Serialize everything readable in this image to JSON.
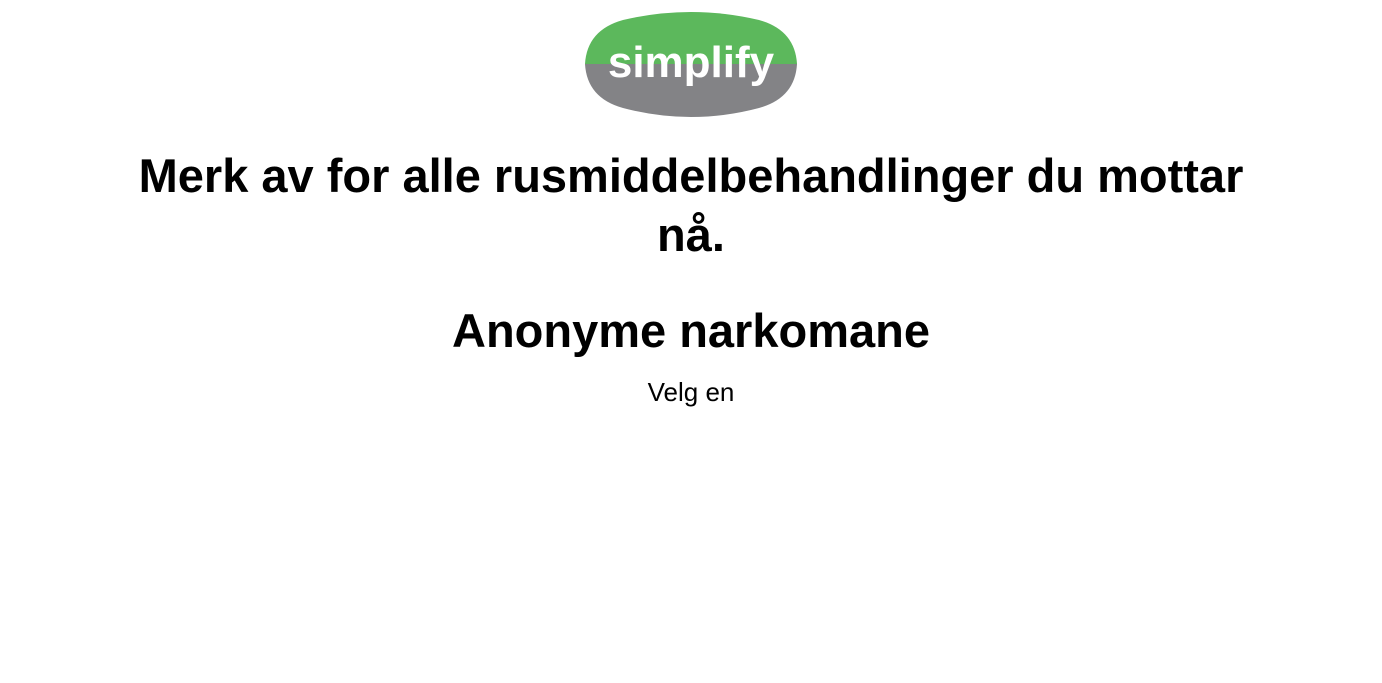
{
  "logo": {
    "text": "simplify",
    "colors": {
      "top": "#5cb85c",
      "bottom": "#838386",
      "text": "#ffffff"
    }
  },
  "question": {
    "title": "Merk av for alle rusmiddelbehandlinger du mottar nå."
  },
  "option": {
    "title": "Anonyme narkomane",
    "choice_label": "Velg en"
  }
}
